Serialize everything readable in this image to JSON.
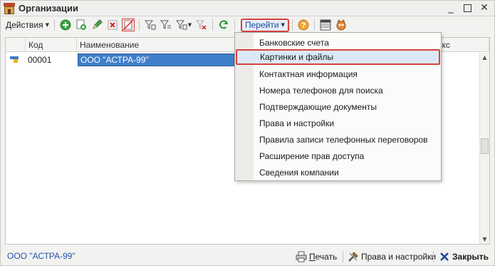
{
  "window": {
    "title": "Организации",
    "close_glyph": "✕",
    "minimize_glyph": "_"
  },
  "toolbar": {
    "actions_label": "Действия",
    "goto_label": "Перейти",
    "icons": [
      "add-icon",
      "copy-icon",
      "edit-icon",
      "delete-icon",
      "mark-delete-icon",
      "filter-icon",
      "filter-list-icon",
      "filter-dropdown-icon",
      "filter-clear-icon",
      "refresh-icon",
      "help-icon",
      "list-settings-icon",
      "view-icon"
    ]
  },
  "table": {
    "columns": [
      "Код",
      "Наименование",
      "Префикс"
    ],
    "rows": [
      {
        "code": "00001",
        "name": "ООО \"АСТРА-99\""
      }
    ]
  },
  "goto_menu": {
    "items": [
      "Банковские счета",
      "Картинки и файлы",
      "Контактная информация",
      "Номера телефонов для поиска",
      "Подтверждающие документы",
      "Права и настройки",
      "Правила записи телефонных переговоров",
      "Расширение прав доступа",
      "Сведения компании"
    ],
    "highlighted_index": 1
  },
  "footer": {
    "status": "ООО \"АСТРА-99\"",
    "print_first": "П",
    "print_rest": "ечать",
    "rights_label": "Права и настройки",
    "close_label": "Закрыть"
  },
  "colors": {
    "highlight_border": "#d9413f",
    "selection": "#3f7fc9",
    "link": "#2453a4"
  }
}
